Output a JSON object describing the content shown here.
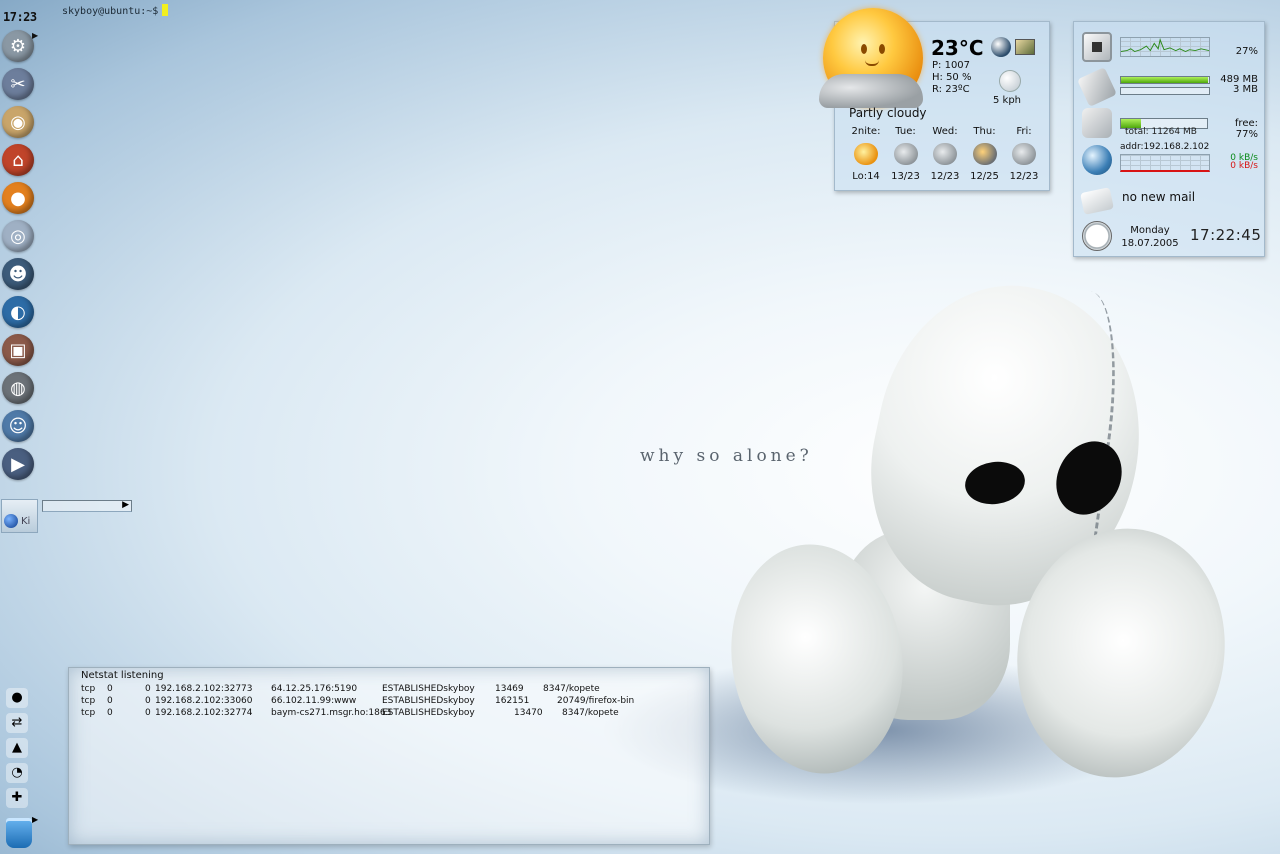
{
  "terminal": {
    "prompt": "skyboy@ubuntu:~$"
  },
  "panel_clock": "17:23",
  "launcher_icons": [
    "settings-gear-icon",
    "tools-icon",
    "package-icon",
    "home-icon",
    "firefox-icon",
    "cd-audio-icon",
    "messenger-icon",
    "browser-icon",
    "camera-icon",
    "webcam-icon",
    "kopete-icon",
    "media-player-icon"
  ],
  "taskbar": {
    "task_label": "Ki"
  },
  "weather": {
    "temp": "23°C",
    "pressure": "P: 1007",
    "humidity": "H: 50 %",
    "real": "R: 23ºC",
    "wind": "5 kph",
    "condition": "Partly cloudy",
    "forecast": [
      {
        "day": "2nite:",
        "temp": "Lo:14",
        "icon": "sun"
      },
      {
        "day": "Tue:",
        "temp": "13/23",
        "icon": "cloud"
      },
      {
        "day": "Wed:",
        "temp": "12/23",
        "icon": "cloud"
      },
      {
        "day": "Thu:",
        "temp": "12/25",
        "icon": "storm"
      },
      {
        "day": "Fri:",
        "temp": "12/23",
        "icon": "cloud"
      }
    ]
  },
  "sysmon": {
    "cpu_percent": "27%",
    "mem_used": "489 MB",
    "swap_used": "3 MB",
    "mem_fill": 0.99,
    "disk_total": "total: 11264 MB",
    "disk_free": "free: 77%",
    "disk_fill": 0.23,
    "net_addr": "addr:192.168.2.102",
    "net_up": "0 kB/s",
    "net_down": "0 kB/s",
    "mail": "no new mail",
    "day": "Monday",
    "date": "18.07.2005",
    "time": "17:22:45"
  },
  "wallpaper": {
    "caption": "why so alone?"
  },
  "netstat": {
    "title": "Netstat listening",
    "rows": [
      {
        "proto": "tcp",
        "recv": "0",
        "send": "0",
        "local": "192.168.2.102:32773",
        "foreign": "64.12.25.176:5190",
        "state": "ESTABLISHEDskyboy",
        "inode": "13469",
        "prog": "8347/kopete"
      },
      {
        "proto": "tcp",
        "recv": "0",
        "send": "0",
        "local": "192.168.2.102:33060",
        "foreign": "66.102.11.99:www",
        "state": "ESTABLISHEDskyboy",
        "inode": "162151",
        "prog": "20749/firefox-bin"
      },
      {
        "proto": "tcp",
        "recv": "0",
        "send": "0",
        "local": "192.168.2.102:32774",
        "foreign": "baym-cs271.msgr.ho:1863",
        "state": "ESTABLISHEDskyboy",
        "inode": "13470",
        "prog": "8347/kopete"
      }
    ]
  },
  "colors": {
    "accent_green": "#4ea80c",
    "net_up": "#0a8a1a",
    "net_down": "#d81414"
  }
}
